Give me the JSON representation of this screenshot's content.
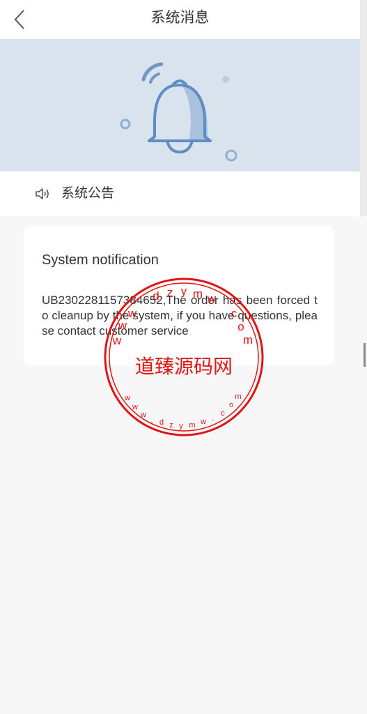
{
  "header": {
    "title": "系统消息",
    "back_icon": "chevron-left-icon"
  },
  "banner": {
    "icon": "bell-icon",
    "colors": {
      "background": "#d8e3ee",
      "bell_stroke": "#5f8cc4",
      "bell_fill": "#a9c1dc"
    }
  },
  "announcement": {
    "icon": "speaker-icon",
    "label": "系统公告"
  },
  "message": {
    "title": "System notification",
    "body": "UB2302281157384652,The order has been forced to cleanup by the system, if you have questions, please contact customer service"
  },
  "watermark": {
    "text": "道臻源码网",
    "url_text": "www.dzymw.com",
    "color": "#e11414"
  }
}
